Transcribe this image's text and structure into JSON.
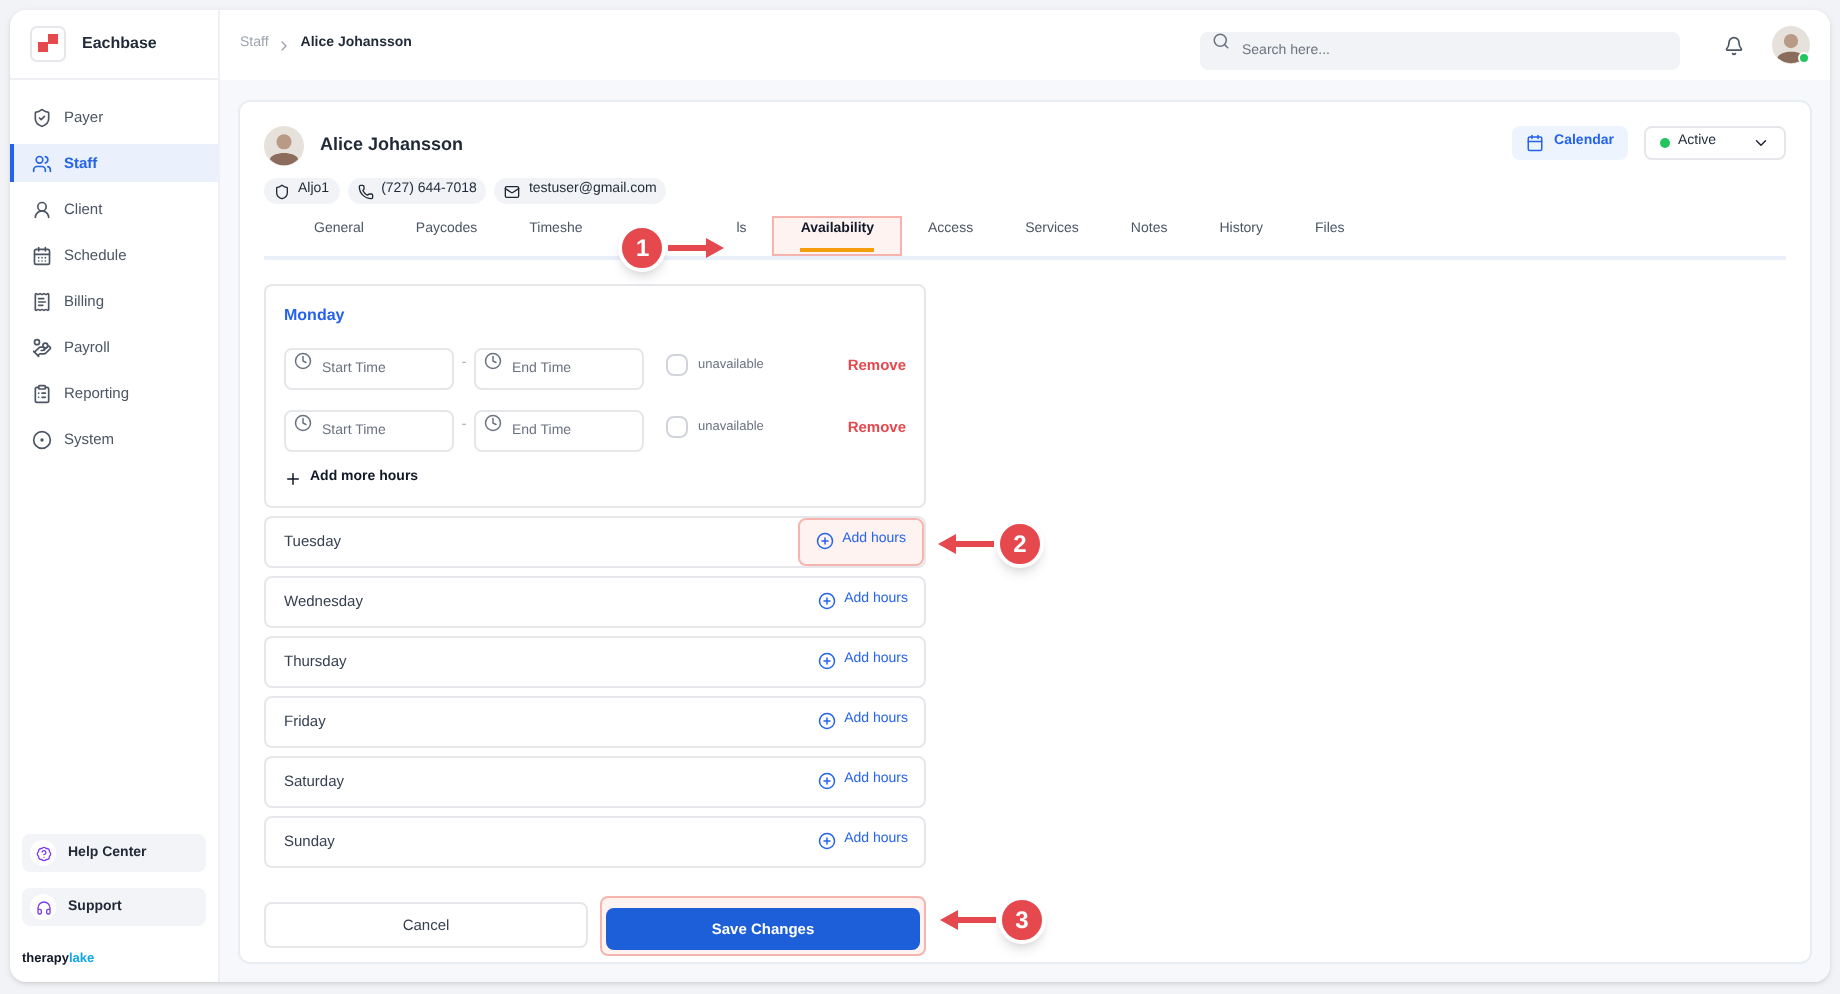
{
  "brand": {
    "name": "Eachbase"
  },
  "sidebar": {
    "items": [
      {
        "label": "Payer",
        "selected": false
      },
      {
        "label": "Staff",
        "selected": true
      },
      {
        "label": "Client",
        "selected": false
      },
      {
        "label": "Schedule",
        "selected": false
      },
      {
        "label": "Billing",
        "selected": false
      },
      {
        "label": "Payroll",
        "selected": false
      },
      {
        "label": "Reporting",
        "selected": false
      },
      {
        "label": "System",
        "selected": false
      }
    ],
    "bottom": [
      {
        "label": "Help Center"
      },
      {
        "label": "Support"
      }
    ],
    "logo": {
      "first": "therapy",
      "second": "lake"
    }
  },
  "breadcrumb": [
    {
      "label": "Staff"
    },
    {
      "label": "Alice Johansson"
    }
  ],
  "search": {
    "placeholder": "Search here..."
  },
  "user": {
    "online": true
  },
  "profile": {
    "name": "Alice Johansson",
    "chips": [
      {
        "text": "Aljo1"
      },
      {
        "text": "(727) 644-7018"
      },
      {
        "text": "testuser@gmail.com"
      }
    ],
    "calendar_button": "Calendar",
    "status": {
      "label": "Active",
      "color": "#22c55e"
    }
  },
  "tabs": [
    {
      "label": "General",
      "selected": false
    },
    {
      "label": "Paycodes",
      "selected": false
    },
    {
      "label": "Timeshe",
      "selected": false
    },
    {
      "label": "ls",
      "selected": false
    },
    {
      "label": "Availability",
      "selected": true,
      "callout": "1"
    },
    {
      "label": "Access",
      "selected": false
    },
    {
      "label": "Services",
      "selected": false
    },
    {
      "label": "Notes",
      "selected": false
    },
    {
      "label": "History",
      "selected": false
    },
    {
      "label": "Files",
      "selected": false
    }
  ],
  "monday": {
    "day": "Monday",
    "slots": [
      {
        "start_placeholder": "Start Time",
        "separator": "-",
        "end_placeholder": "End Time",
        "unavailable_label": "unavailable",
        "unavailable": false,
        "remove": "Remove"
      },
      {
        "start_placeholder": "Start Time",
        "separator": "-",
        "end_placeholder": "End Time",
        "unavailable_label": "unavailable",
        "unavailable": false,
        "remove": "Remove"
      }
    ],
    "add_more": "Add more hours"
  },
  "days": [
    {
      "day": "Tuesday",
      "action": "Add hours",
      "callout": "2"
    },
    {
      "day": "Wednesday",
      "action": "Add hours"
    },
    {
      "day": "Thursday",
      "action": "Add hours"
    },
    {
      "day": "Friday",
      "action": "Add hours"
    },
    {
      "day": "Saturday",
      "action": "Add hours"
    },
    {
      "day": "Sunday",
      "action": "Add hours"
    }
  ],
  "buttons": {
    "cancel": {
      "label": "Cancel"
    },
    "save": {
      "label": "Save Changes",
      "callout": "3"
    }
  }
}
